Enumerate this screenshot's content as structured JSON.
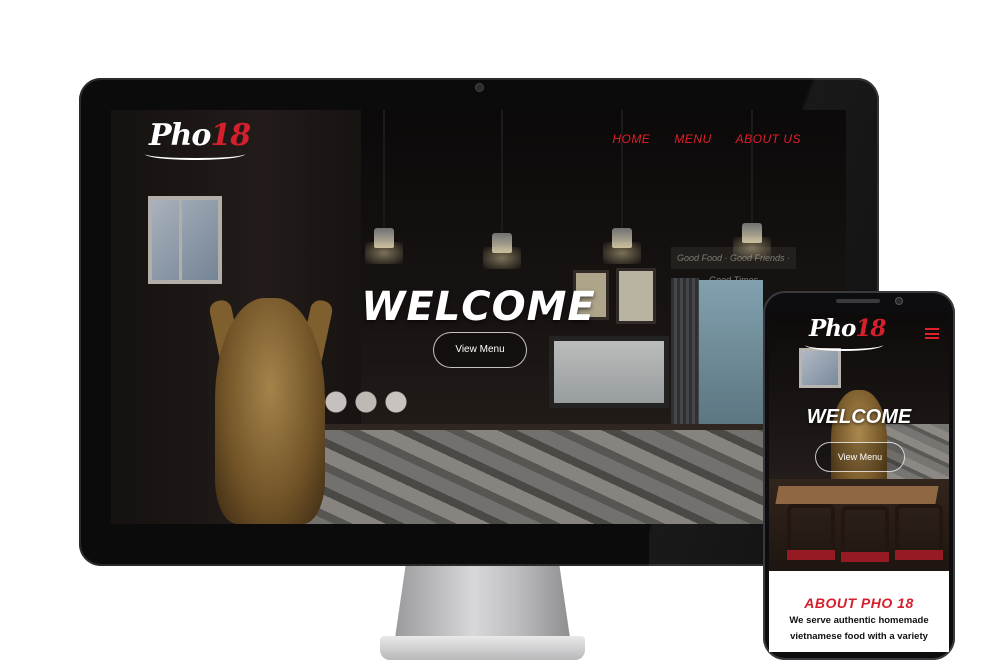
{
  "site": {
    "logo": {
      "word": "Pho",
      "number": "18"
    },
    "nav": [
      {
        "label": "HOME"
      },
      {
        "label": "MENU"
      },
      {
        "label": "ABOUT US"
      }
    ],
    "hero": {
      "title": "WELCOME",
      "button_label": "View Menu",
      "sign_text": "Good Food · Good Friends · Good Times"
    },
    "about": {
      "title": "ABOUT PHO 18",
      "text": "We serve authentic homemade vietnamese food with a variety"
    }
  },
  "colors": {
    "accent_red": "#d4202c",
    "nav_red": "#e11f2a",
    "hero_text": "#ffffff",
    "device_bezel": "#0b0b0c"
  },
  "icons": {
    "menu": "hamburger-icon",
    "camera": "camera-icon"
  }
}
